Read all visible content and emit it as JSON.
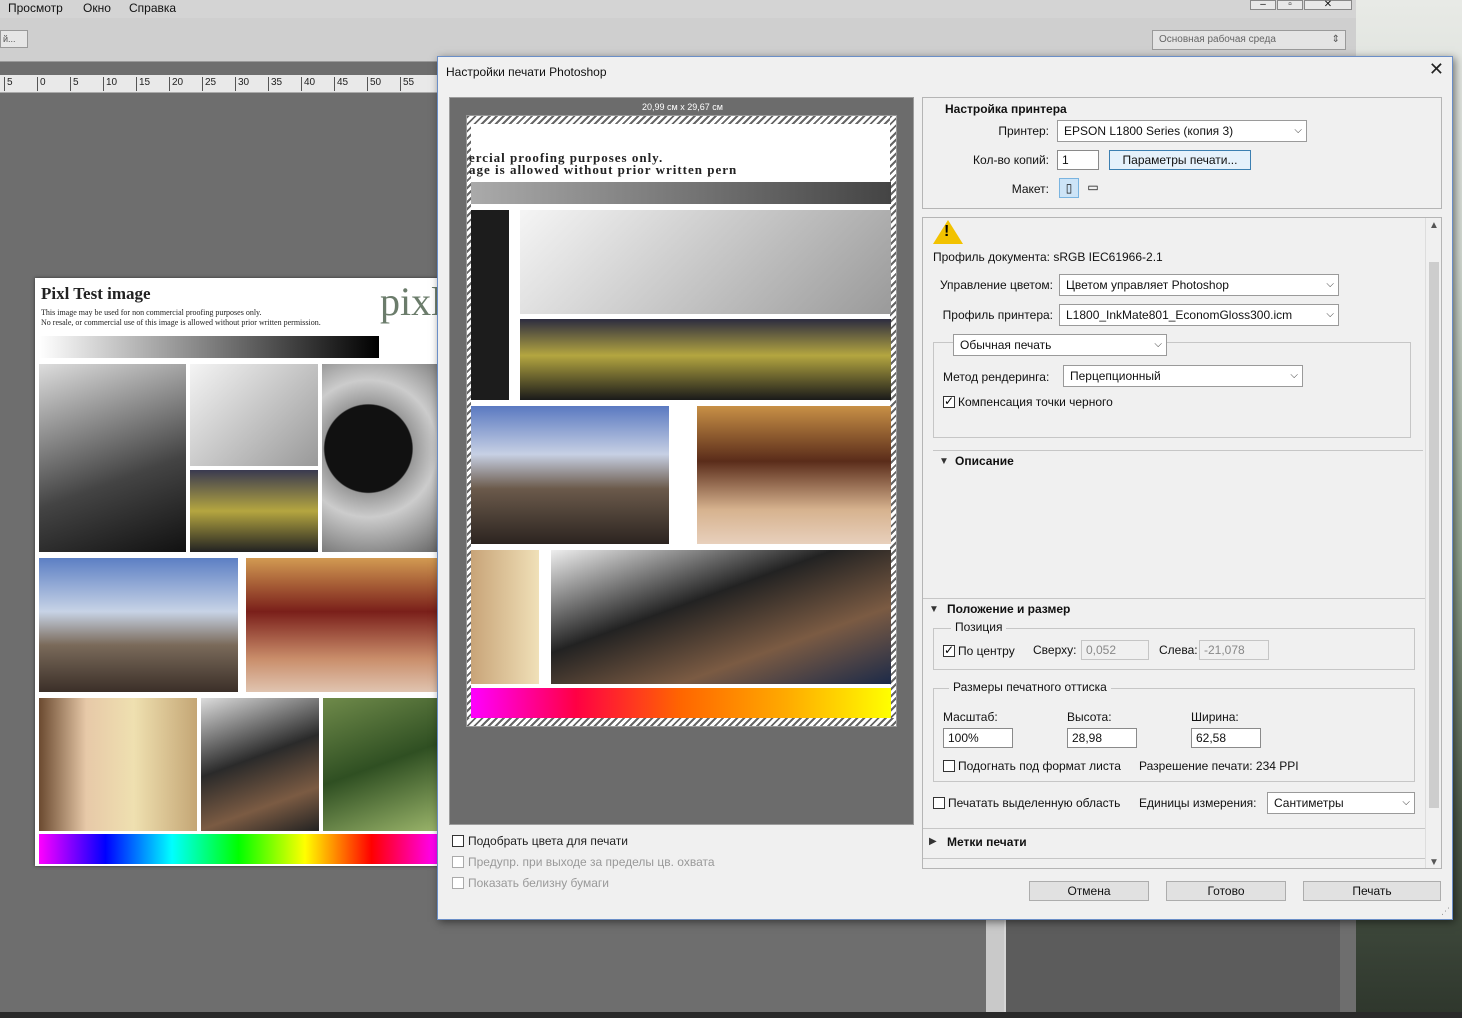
{
  "menu": {
    "items": [
      "Просмотр",
      "Окно",
      "Справка"
    ]
  },
  "optbar": {
    "left_stub": "й...",
    "workspace": "Основная рабочая среда"
  },
  "ruler": {
    "ticks": [
      "5",
      "0",
      "5",
      "10",
      "15",
      "20",
      "25",
      "30",
      "35",
      "40",
      "45",
      "50",
      "55"
    ]
  },
  "canvas_image": {
    "title": "Pixl Test image",
    "line1": "This image may be used for non commercial proofing purposes only.",
    "line2": "No resale, or commercial use of this image is allowed without prior written permission.",
    "logo": "pixl"
  },
  "dialog": {
    "title": "Настройки печати Photoshop",
    "close": "✕",
    "paper_size": "20,99 см x 29,67 см",
    "preview_text1": "ercial proofing purposes only.",
    "preview_text2": "age is allowed without prior written pern",
    "bottom_options": [
      {
        "label": "Подобрать цвета для печати",
        "checked": false,
        "enabled": true
      },
      {
        "label": "Предупр. при выходе за пределы цв. охвата",
        "checked": false,
        "enabled": false
      },
      {
        "label": "Показать белизну бумаги",
        "checked": false,
        "enabled": false
      }
    ],
    "printer_setup": {
      "title": "Настройка принтера",
      "printer_label": "Принтер:",
      "printer_value": "EPSON L1800 Series (копия 3)",
      "copies_label": "Кол-во копий:",
      "copies_value": "1",
      "print_params_btn": "Параметры печати...",
      "layout_label": "Макет:"
    },
    "color": {
      "doc_profile": "Профиль документа: sRGB IEC61966-2.1",
      "color_mgmt_label": "Управление цветом:",
      "color_mgmt_value": "Цветом управляет Photoshop",
      "printer_profile_label": "Профиль принтера:",
      "printer_profile_value": "L1800_InkMate801_EconomGloss300.icm",
      "print_mode": "Обычная печать",
      "render_label": "Метод рендеринга:",
      "render_value": "Перцепционный",
      "black_point": "Компенсация точки черного"
    },
    "description": {
      "title": "Описание"
    },
    "position_size": {
      "title": "Положение и размер",
      "position_caption": "Позиция",
      "center_label": "По центру",
      "top_label": "Сверху:",
      "top_value": "0,052",
      "left_label": "Слева:",
      "left_value": "-21,078",
      "size_caption": "Размеры печатного оттиска",
      "scale_label": "Масштаб:",
      "scale_value": "100%",
      "height_label": "Высота:",
      "height_value": "28,98",
      "width_label": "Ширина:",
      "width_value": "62,58",
      "fit_label": "Подогнать под формат листа",
      "resolution": "Разрешение печати: 234 PPI",
      "print_selection": "Печатать выделенную область",
      "units_label": "Единицы измерения:",
      "units_value": "Сантиметры"
    },
    "marks": {
      "title": "Метки печати"
    },
    "buttons": {
      "cancel": "Отмена",
      "done": "Готово",
      "print": "Печать"
    }
  },
  "colors": {
    "accent": "#3c7fb1",
    "dialog_bg": "#f0f0f0",
    "warning": "#f2c200"
  }
}
